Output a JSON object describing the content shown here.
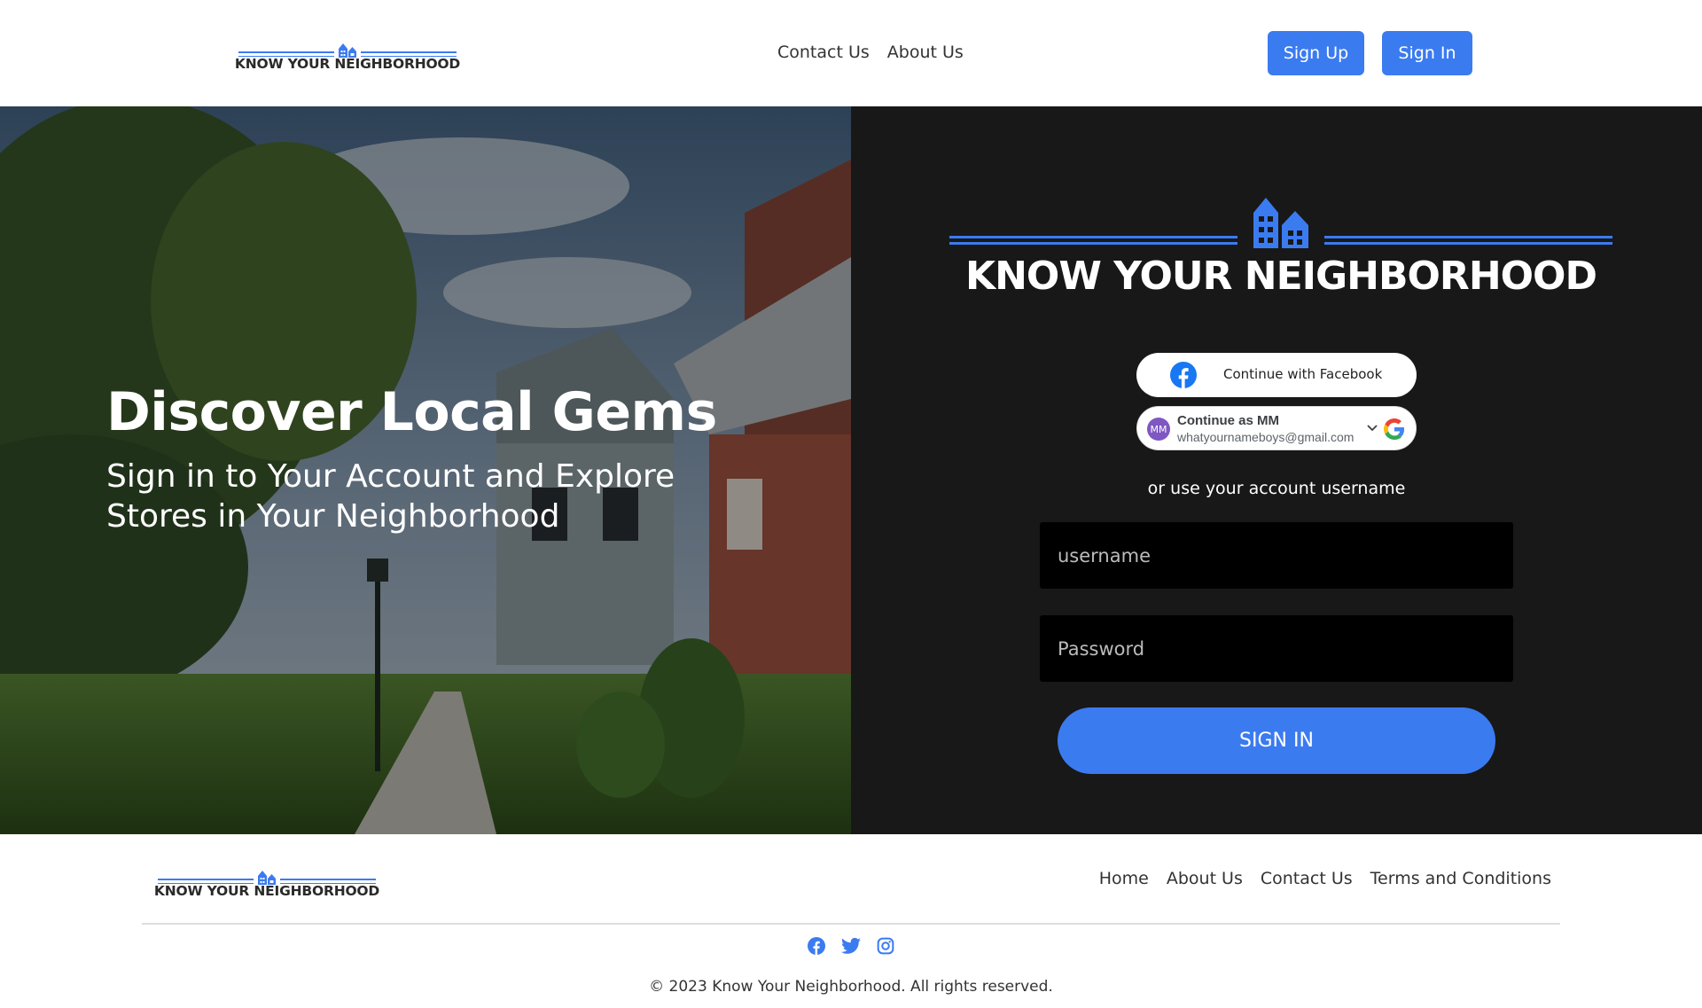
{
  "brand": {
    "name": "KNOW YOUR NEIGHBORHOOD",
    "accent": "#3b7bf0"
  },
  "header": {
    "nav": [
      {
        "label": "Contact Us"
      },
      {
        "label": "About Us"
      }
    ],
    "signup_label": "Sign Up",
    "signin_label": "Sign In"
  },
  "hero": {
    "title": "Discover Local Gems",
    "subtitle": "Sign in to Your Account and Explore Stores in Your Neighborhood"
  },
  "signin": {
    "facebook_label": "Continue with Facebook",
    "google_name": "Continue as MM",
    "google_email": "whatyournameboys@gmail.com",
    "google_avatar": "MM",
    "or_text": "or use your account username",
    "username_placeholder": "username",
    "password_placeholder": "Password",
    "submit_label": "SIGN IN"
  },
  "footer": {
    "nav": [
      {
        "label": "Home"
      },
      {
        "label": "About Us"
      },
      {
        "label": "Contact Us"
      },
      {
        "label": "Terms and Conditions"
      }
    ],
    "socials": [
      "facebook-icon",
      "twitter-icon",
      "instagram-icon"
    ],
    "copyright": "© 2023 Know Your Neighborhood. All rights reserved."
  }
}
